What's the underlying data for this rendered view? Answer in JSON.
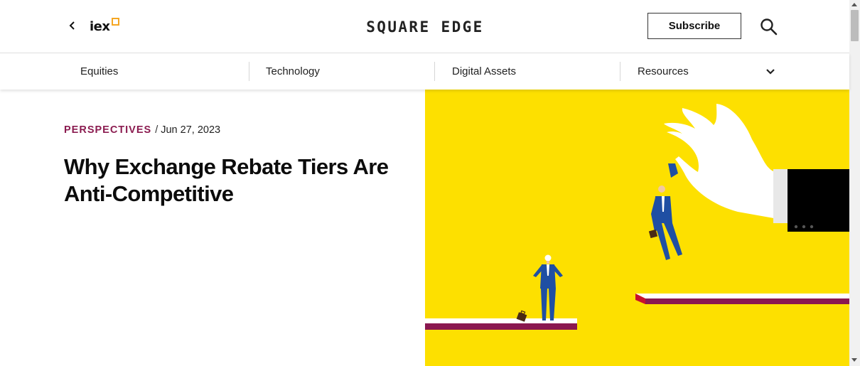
{
  "header": {
    "logo_text": "iex",
    "brand": "SQUARE EDGE",
    "subscribe_label": "Subscribe",
    "icons": [
      "chevron-left-icon",
      "iex-logo",
      "search-icon"
    ]
  },
  "nav": {
    "items": [
      {
        "label": "Equities"
      },
      {
        "label": "Technology"
      },
      {
        "label": "Digital Assets"
      },
      {
        "label": "Resources"
      }
    ],
    "expand_icon": "chevron-down-icon"
  },
  "article": {
    "category": "PERSPECTIVES",
    "separator": "/",
    "date": "Jun 27, 2023",
    "title": "Why Exchange Rebate Tiers Are Anti-Competitive"
  },
  "colors": {
    "accent": "#8b1c50",
    "logo_orange": "#f5a623",
    "hero_yellow": "#fde000",
    "suit_blue": "#1f4fa3"
  }
}
